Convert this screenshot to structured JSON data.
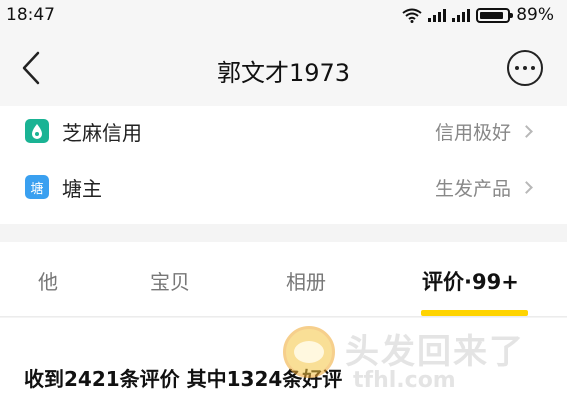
{
  "status_bar": {
    "time": "18:47",
    "battery": "89%",
    "battery_level": 0.89
  },
  "nav": {
    "title": "郭文才1973"
  },
  "info_rows": [
    {
      "icon": "sesame-credit-icon",
      "icon_color": "#1ab394",
      "label": "芝麻信用",
      "value": "信用极好"
    },
    {
      "icon_glyph": "塘",
      "icon_color": "#3aa0f0",
      "label": "塘主",
      "value": "生发产品"
    }
  ],
  "tabs": [
    {
      "label": "他"
    },
    {
      "label": "宝贝"
    },
    {
      "label": "相册"
    },
    {
      "label": "评价·99+",
      "active": true
    }
  ],
  "accent_color": "#ffd400",
  "reviews": {
    "part1": "收到",
    "total": "2421",
    "part2": "条评价 其中",
    "good": "1324",
    "part3": "条好评"
  },
  "watermark": {
    "text": "头发回来了",
    "url": "tfhl.com"
  }
}
